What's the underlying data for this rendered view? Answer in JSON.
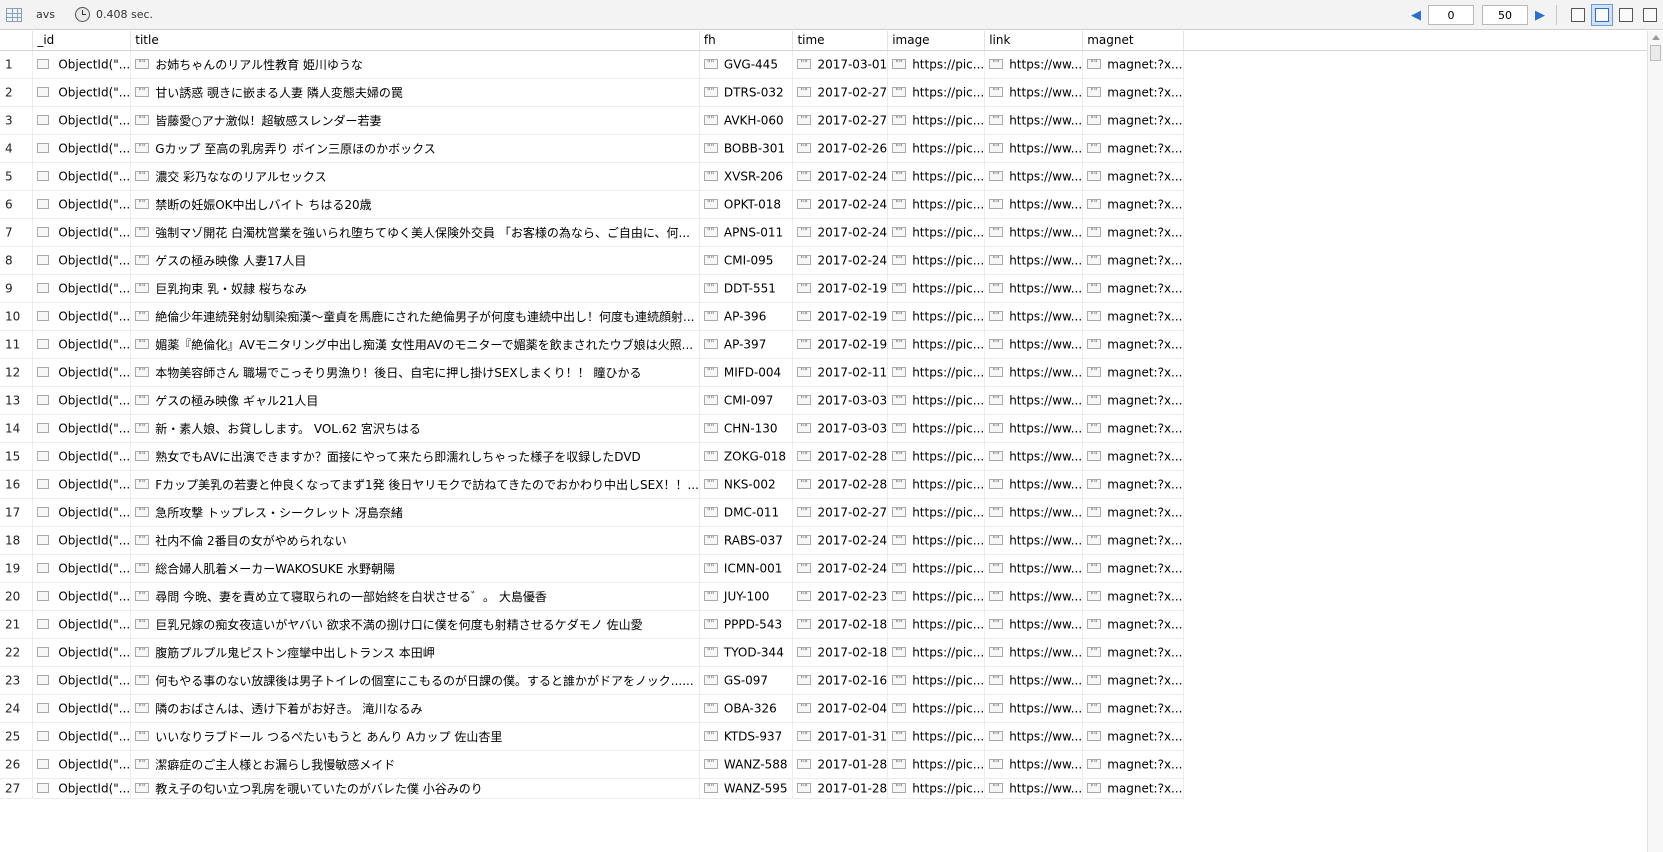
{
  "toolbar": {
    "collection": "avs",
    "time": "0.408 sec.",
    "skip": "0",
    "limit": "50",
    "prev_glyph": "◀",
    "next_glyph": "▶",
    "icons": [
      "table-view-icon",
      "tree-view-icon",
      "text-view-icon",
      "expand-icon"
    ]
  },
  "columns": [
    "_id",
    "title",
    "fh",
    "time",
    "image",
    "link",
    "magnet"
  ],
  "rows": [
    {
      "n": "1",
      "id": "ObjectId(\"...",
      "title": "お姉ちゃんのリアル性教育 姫川ゆうな",
      "fh": "GVG-445",
      "time": "2017-03-01",
      "image": "https://pic...",
      "link": "https://ww...",
      "magnet": "magnet:?x..."
    },
    {
      "n": "2",
      "id": "ObjectId(\"...",
      "title": "甘い誘惑 覗きに嵌まる人妻 隣人変態夫婦の罠",
      "fh": "DTRS-032",
      "time": "2017-02-27",
      "image": "https://pic...",
      "link": "https://ww...",
      "magnet": "magnet:?x..."
    },
    {
      "n": "3",
      "id": "ObjectId(\"...",
      "title": "皆藤愛○アナ激似！超敏感スレンダー若妻",
      "fh": "AVKH-060",
      "time": "2017-02-27",
      "image": "https://pic...",
      "link": "https://ww...",
      "magnet": "magnet:?x..."
    },
    {
      "n": "4",
      "id": "ObjectId(\"...",
      "title": "Gカップ 至高の乳房弄り ボイン三原ほのかボックス",
      "fh": "BOBB-301",
      "time": "2017-02-26",
      "image": "https://pic...",
      "link": "https://ww...",
      "magnet": "magnet:?x..."
    },
    {
      "n": "5",
      "id": "ObjectId(\"...",
      "title": "濃交 彩乃ななのリアルセックス",
      "fh": "XVSR-206",
      "time": "2017-02-24",
      "image": "https://pic...",
      "link": "https://ww...",
      "magnet": "magnet:?x..."
    },
    {
      "n": "6",
      "id": "ObjectId(\"...",
      "title": "禁断の妊娠OK中出しバイト ちはる20歳",
      "fh": "OPKT-018",
      "time": "2017-02-24",
      "image": "https://pic...",
      "link": "https://ww...",
      "magnet": "magnet:?x..."
    },
    {
      "n": "7",
      "id": "ObjectId(\"...",
      "title": "強制マゾ開花 白濁枕営業を強いられ堕ちてゆく美人保険外交員 「お客様の為なら、ご自由に、何...",
      "fh": "APNS-011",
      "time": "2017-02-24",
      "image": "https://pic...",
      "link": "https://ww...",
      "magnet": "magnet:?x..."
    },
    {
      "n": "8",
      "id": "ObjectId(\"...",
      "title": "ゲスの極み映像 人妻17人目",
      "fh": "CMI-095",
      "time": "2017-02-24",
      "image": "https://pic...",
      "link": "https://ww...",
      "magnet": "magnet:?x..."
    },
    {
      "n": "9",
      "id": "ObjectId(\"...",
      "title": "巨乳拘束 乳・奴隷 桜ちなみ",
      "fh": "DDT-551",
      "time": "2017-02-19",
      "image": "https://pic...",
      "link": "https://ww...",
      "magnet": "magnet:?x..."
    },
    {
      "n": "10",
      "id": "ObjectId(\"...",
      "title": "絶倫少年連続発射幼馴染痴漢～童貞を馬鹿にされた絶倫男子が何度も連続中出し！何度も連続顔射...",
      "fh": "AP-396",
      "time": "2017-02-19",
      "image": "https://pic...",
      "link": "https://ww...",
      "magnet": "magnet:?x..."
    },
    {
      "n": "11",
      "id": "ObjectId(\"...",
      "title": "媚薬『絶倫化』AVモニタリング中出し痴漢 女性用AVのモニターで媚薬を飲まされたウブ娘は火照...",
      "fh": "AP-397",
      "time": "2017-02-19",
      "image": "https://pic...",
      "link": "https://ww...",
      "magnet": "magnet:?x..."
    },
    {
      "n": "12",
      "id": "ObjectId(\"...",
      "title": "本物美容師さん 職場でこっそり男漁り！後日、自宅に押し掛けSEXしまくり！！ 瞳ひかる",
      "fh": "MIFD-004",
      "time": "2017-02-11",
      "image": "https://pic...",
      "link": "https://ww...",
      "magnet": "magnet:?x..."
    },
    {
      "n": "13",
      "id": "ObjectId(\"...",
      "title": "ゲスの極み映像 ギャル21人目",
      "fh": "CMI-097",
      "time": "2017-03-03",
      "image": "https://pic...",
      "link": "https://ww...",
      "magnet": "magnet:?x..."
    },
    {
      "n": "14",
      "id": "ObjectId(\"...",
      "title": "新・素人娘、お貸しします。 VOL.62 宮沢ちはる",
      "fh": "CHN-130",
      "time": "2017-03-03",
      "image": "https://pic...",
      "link": "https://ww...",
      "magnet": "magnet:?x..."
    },
    {
      "n": "15",
      "id": "ObjectId(\"...",
      "title": "熟女でもAVに出演できますか？面接にやって来たら即濡れしちゃった様子を収録したDVD",
      "fh": "ZOKG-018",
      "time": "2017-02-28",
      "image": "https://pic...",
      "link": "https://ww...",
      "magnet": "magnet:?x..."
    },
    {
      "n": "16",
      "id": "ObjectId(\"...",
      "title": "Fカップ美乳の若妻と仲良くなってまず1発 後日ヤリモクで訪ねてきたのでおかわり中出しSEX！！...",
      "fh": "NKS-002",
      "time": "2017-02-28",
      "image": "https://pic...",
      "link": "https://ww...",
      "magnet": "magnet:?x..."
    },
    {
      "n": "17",
      "id": "ObjectId(\"...",
      "title": "急所攻撃 トップレス・シークレット 冴島奈緒",
      "fh": "DMC-011",
      "time": "2017-02-27",
      "image": "https://pic...",
      "link": "https://ww...",
      "magnet": "magnet:?x..."
    },
    {
      "n": "18",
      "id": "ObjectId(\"...",
      "title": "社内不倫 2番目の女がやめられない",
      "fh": "RABS-037",
      "time": "2017-02-24",
      "image": "https://pic...",
      "link": "https://ww...",
      "magnet": "magnet:?x..."
    },
    {
      "n": "19",
      "id": "ObjectId(\"...",
      "title": "総合婦人肌着メーカーWAKOSUKE 水野朝陽",
      "fh": "ICMN-001",
      "time": "2017-02-24",
      "image": "https://pic...",
      "link": "https://ww...",
      "magnet": "magnet:?x..."
    },
    {
      "n": "20",
      "id": "ObjectId(\"...",
      "title": "尋問 今晩、妻を責め立て寝取られの一部始終を白状させる゛。 大島優香",
      "fh": "JUY-100",
      "time": "2017-02-23",
      "image": "https://pic...",
      "link": "https://ww...",
      "magnet": "magnet:?x..."
    },
    {
      "n": "21",
      "id": "ObjectId(\"...",
      "title": "巨乳兄嫁の痴女夜這いがヤバい 欲求不満の捌け口に僕を何度も射精させるケダモノ 佐山愛",
      "fh": "PPPD-543",
      "time": "2017-02-18",
      "image": "https://pic...",
      "link": "https://ww...",
      "magnet": "magnet:?x..."
    },
    {
      "n": "22",
      "id": "ObjectId(\"...",
      "title": "腹筋プルプル鬼ピストン痙攣中出しトランス 本田岬",
      "fh": "TYOD-344",
      "time": "2017-02-18",
      "image": "https://pic...",
      "link": "https://ww...",
      "magnet": "magnet:?x..."
    },
    {
      "n": "23",
      "id": "ObjectId(\"...",
      "title": "何もやる事のない放課後は男子トイレの個室にこもるのが日課の僕。すると誰かがドアをノック......",
      "fh": "GS-097",
      "time": "2017-02-16",
      "image": "https://pic...",
      "link": "https://ww...",
      "magnet": "magnet:?x..."
    },
    {
      "n": "24",
      "id": "ObjectId(\"...",
      "title": "隣のおばさんは、透け下着がお好き。 滝川なるみ",
      "fh": "OBA-326",
      "time": "2017-02-04",
      "image": "https://pic...",
      "link": "https://ww...",
      "magnet": "magnet:?x..."
    },
    {
      "n": "25",
      "id": "ObjectId(\"...",
      "title": "いいなりラブドール つるぺたいもうと あんり Aカップ 佐山杏里",
      "fh": "KTDS-937",
      "time": "2017-01-31",
      "image": "https://pic...",
      "link": "https://ww...",
      "magnet": "magnet:?x..."
    },
    {
      "n": "26",
      "id": "ObjectId(\"...",
      "title": "潔癖症のご主人様とお漏らし我慢敏感メイド",
      "fh": "WANZ-588",
      "time": "2017-01-28",
      "image": "https://pic...",
      "link": "https://ww...",
      "magnet": "magnet:?x..."
    },
    {
      "n": "27",
      "id": "ObjectId(\"...",
      "title": "教え子の匂い立つ乳房を覗いていたのがバレた僕 小谷みのり",
      "fh": "WANZ-595",
      "time": "2017-01-28",
      "image": "https://pic...",
      "link": "https://ww...",
      "magnet": "magnet:?x..."
    }
  ]
}
